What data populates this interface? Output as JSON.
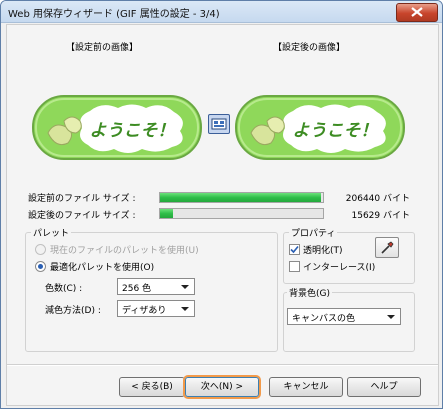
{
  "window": {
    "title": "Web 用保存ウィザード (GIF 属性の設定 - 3/4)"
  },
  "previews": {
    "before_label": "【設定前の画像】",
    "after_label": "【設定後の画像】",
    "banner_text": "ようこそ！"
  },
  "filesizes": {
    "before": {
      "label": "設定前のファイル サイズ :",
      "value": "206440 バイト",
      "fill_fraction": 0.99
    },
    "after": {
      "label": "設定後のファイル サイズ :",
      "value": "15629 バイト",
      "fill_fraction": 0.08
    }
  },
  "palette": {
    "title": "パレット",
    "option_current": "現在のファイルのパレットを使用(U)",
    "option_optimized": "最適化パレットを使用(O)",
    "colors_label": "色数(C) :",
    "colors_value": "256 色",
    "reduce_label": "減色方法(D) :",
    "reduce_value": "ディザあり"
  },
  "properties": {
    "title": "プロパティ",
    "transparent_label": "透明化(T)",
    "transparent_checked": true,
    "interlace_label": "インターレース(I)",
    "interlace_checked": false
  },
  "background": {
    "title": "背景色(G)",
    "value": "キャンバスの色"
  },
  "buttons": {
    "back": "< 戻る(B)",
    "next": "次へ(N) >",
    "cancel": "キャンセル",
    "help": "ヘルプ"
  },
  "colors": {
    "progress_green": "#2fbe49",
    "banner_green": "#8fd85a",
    "accent_blue": "#2a5fb3",
    "focus_orange": "#f29a4a"
  }
}
